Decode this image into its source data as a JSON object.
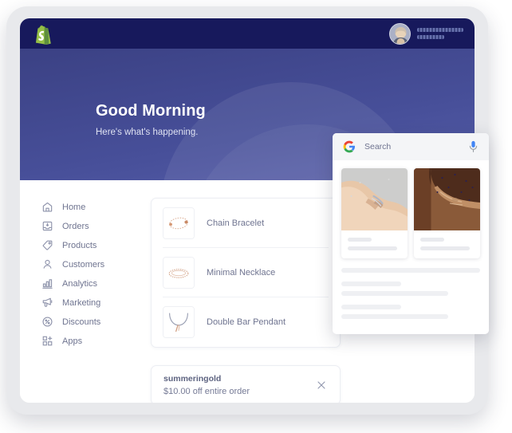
{
  "app": {
    "brand_icon": "shopify-bag-icon",
    "topbar_bg": "#17195c",
    "hero_bg_start": "#3b4184",
    "hero_bg_end": "#555da8"
  },
  "account": {
    "avatar": "user-avatar-photo",
    "name_redacted": true,
    "subtitle_redacted": true
  },
  "hero": {
    "title": "Good Morning",
    "subtitle": "Here's what's happening."
  },
  "sidebar": {
    "items": [
      {
        "label": "Home",
        "icon": "home-icon"
      },
      {
        "label": "Orders",
        "icon": "orders-inbox-icon"
      },
      {
        "label": "Products",
        "icon": "tag-icon"
      },
      {
        "label": "Customers",
        "icon": "person-icon"
      },
      {
        "label": "Analytics",
        "icon": "bar-chart-icon"
      },
      {
        "label": "Marketing",
        "icon": "megaphone-icon"
      },
      {
        "label": "Discounts",
        "icon": "percent-circle-icon"
      },
      {
        "label": "Apps",
        "icon": "grid-plus-icon"
      }
    ]
  },
  "products": {
    "items": [
      {
        "name": "Chain Bracelet",
        "thumb": "chain-bracelet-thumb"
      },
      {
        "name": "Minimal Necklace",
        "thumb": "minimal-necklace-thumb"
      },
      {
        "name": "Double Bar Pendant",
        "thumb": "double-bar-pendant-thumb"
      }
    ]
  },
  "discount": {
    "code": "summeringold",
    "description": "$10.00 off entire order",
    "close_icon": "close-x-icon"
  },
  "google_panel": {
    "logo": "google-g-icon",
    "search_placeholder": "Search",
    "mic_icon": "microphone-icon",
    "results": [
      {
        "image": "bracelet-on-wrist-photo"
      },
      {
        "image": "necklace-on-neck-photo"
      }
    ]
  }
}
